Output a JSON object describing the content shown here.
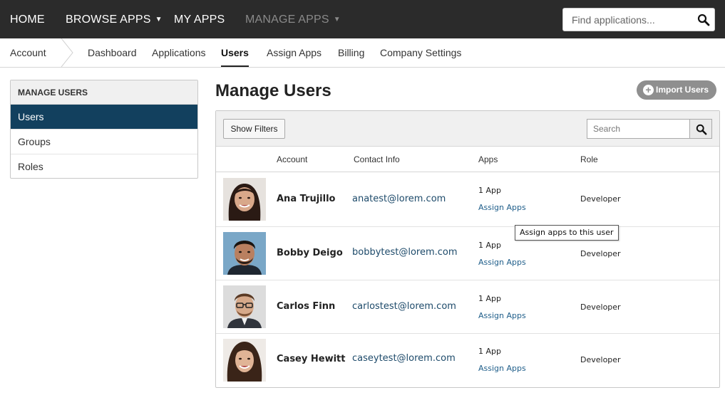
{
  "topnav": {
    "home": "HOME",
    "browse_apps": "BROWSE APPS",
    "my_apps": "MY APPS",
    "manage_apps": "MANAGE APPS",
    "search_placeholder": "Find applications..."
  },
  "subnav": {
    "account": "Account",
    "items": [
      "Dashboard",
      "Applications",
      "Users",
      "Assign Apps",
      "Billing",
      "Company Settings"
    ],
    "active": "Users"
  },
  "sidebar": {
    "heading": "MANAGE USERS",
    "items": [
      {
        "label": "Users",
        "active": true
      },
      {
        "label": "Groups",
        "active": false
      },
      {
        "label": "Roles",
        "active": false
      }
    ]
  },
  "main": {
    "title": "Manage Users",
    "import_label": "Import Users",
    "show_filters_label": "Show Filters",
    "search_placeholder": "Search",
    "columns": [
      "Account",
      "Contact Info",
      "Apps",
      "Role"
    ],
    "rows": [
      {
        "name": "Ana Trujillo",
        "email": "anatest@lorem.com",
        "apps": "1 App",
        "assign": "Assign Apps",
        "role": "Developer"
      },
      {
        "name": "Bobby Deigo",
        "email": "bobbytest@lorem.com",
        "apps": "1 App",
        "assign": "Assign Apps",
        "role": "Developer"
      },
      {
        "name": "Carlos Finn",
        "email": "carlostest@lorem.com",
        "apps": "1 App",
        "assign": "Assign Apps",
        "role": "Developer"
      },
      {
        "name": "Casey Hewitt",
        "email": "caseytest@lorem.com",
        "apps": "1 App",
        "assign": "Assign Apps",
        "role": "Developer"
      }
    ],
    "tooltip": "Assign apps to this user"
  },
  "colors": {
    "topnav_bg": "#2b2b2b",
    "active_sidebar": "#12405e",
    "link": "#1f5e8a",
    "import_button": "#8f8f8f"
  }
}
